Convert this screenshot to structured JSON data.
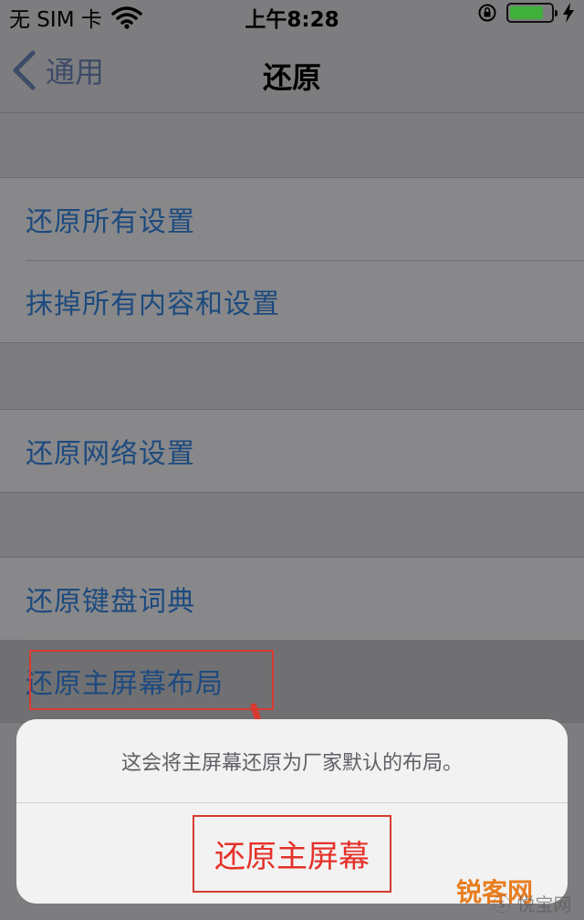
{
  "status_bar": {
    "carrier": "无 SIM 卡",
    "time": "上午8:28",
    "battery_level": 0.82,
    "battery_color": "#3fb13a"
  },
  "nav": {
    "back_label": "通用",
    "title": "还原"
  },
  "groups": [
    {
      "items": [
        "还原所有设置",
        "抹掉所有内容和设置"
      ]
    },
    {
      "items": [
        "还原网络设置"
      ]
    },
    {
      "items": [
        "还原键盘词典",
        "还原主屏幕布局"
      ]
    }
  ],
  "action_sheet": {
    "message": "这会将主屏幕还原为厂家默认的布局。",
    "action_label": "还原主屏幕",
    "destructive_color": "#e5312a"
  },
  "watermark": {
    "brand": "锐客网",
    "sub": "ⓢ 悦宝网客"
  }
}
